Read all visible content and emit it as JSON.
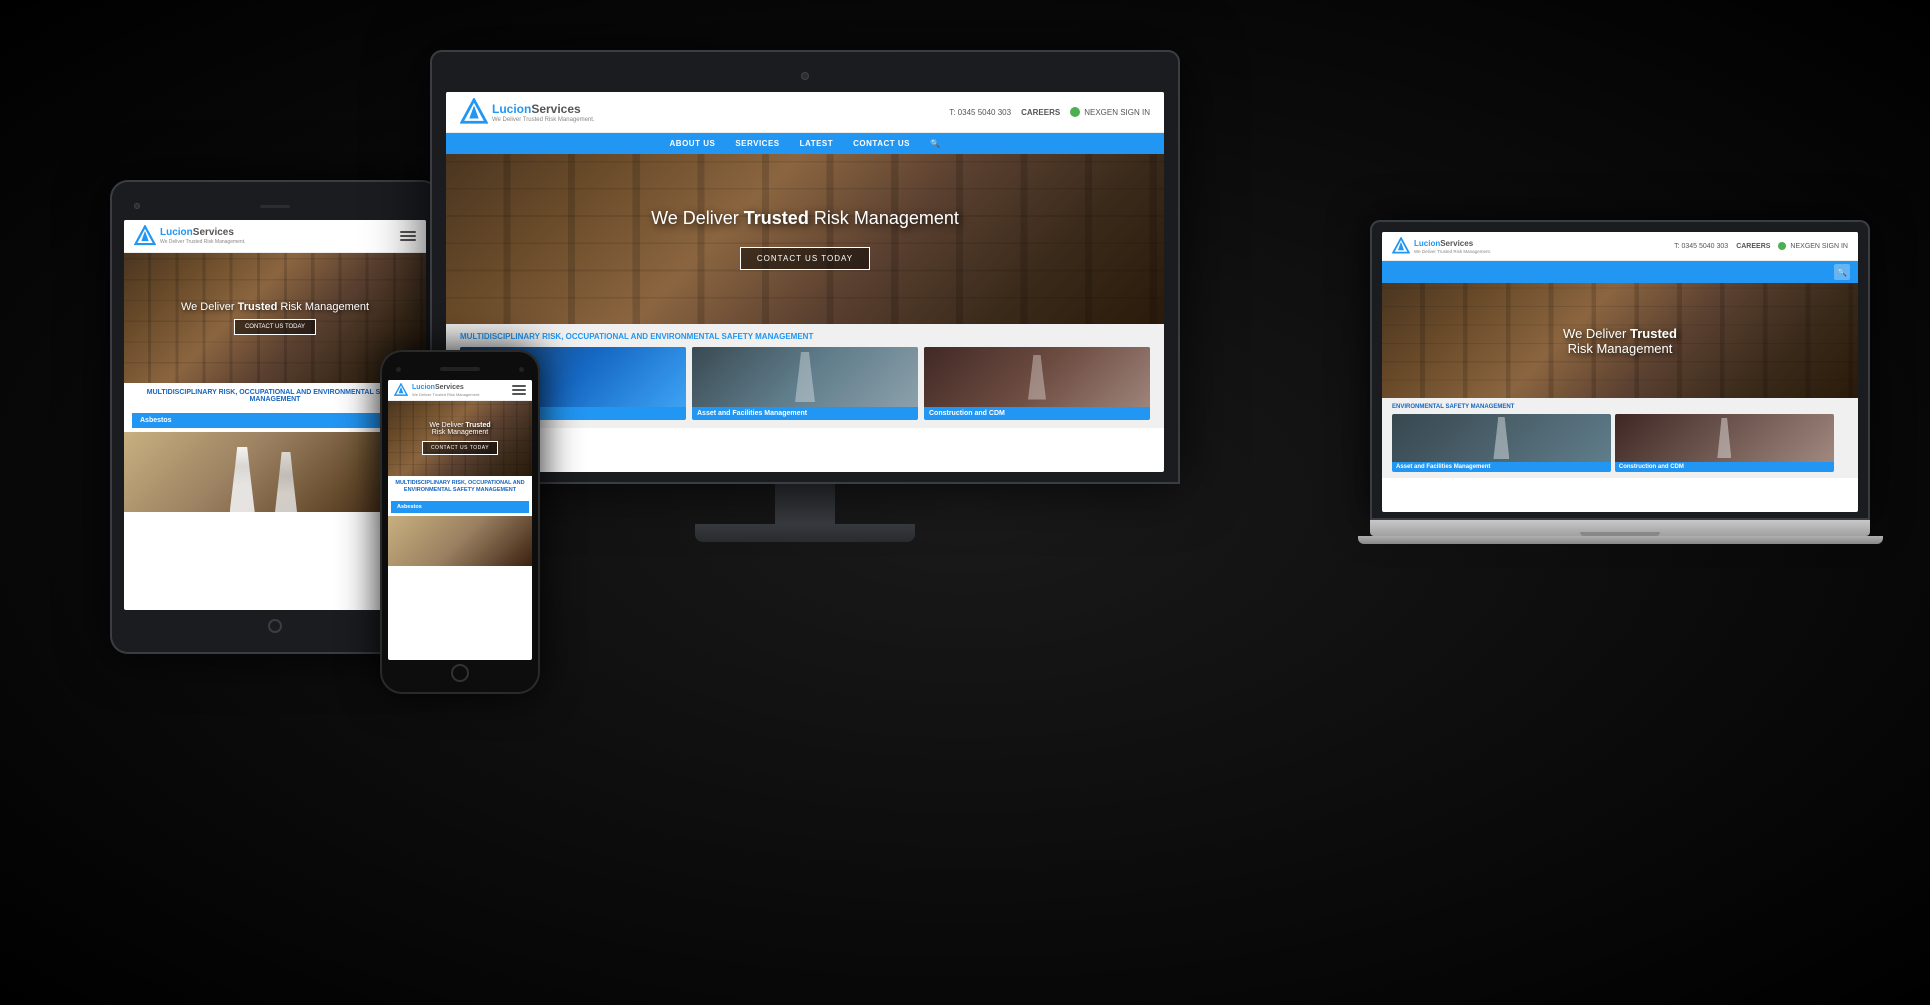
{
  "scene": {
    "background": "black"
  },
  "website": {
    "logo": {
      "brand_prefix": "Lucion",
      "brand_suffix": "Services",
      "tagline": "We Deliver Trusted Risk Management."
    },
    "header": {
      "phone": "T: 0345 5040 303",
      "careers": "CAREERS",
      "nexgen": "NEXGEN SIGN IN"
    },
    "nav": {
      "items": [
        "ABOUT US",
        "SERVICES",
        "LATEST",
        "CONTACT US"
      ]
    },
    "hero": {
      "headline_pre": "We Deliver ",
      "headline_bold": "Trusted",
      "headline_post": " Risk Management",
      "cta": "CONTACT US TODAY"
    },
    "services_section": {
      "title": "MULTIDISCIPLINARY RISK, OCCUPATIONAL AND ENVIRONMENTAL SAFETY MANAGEMENT",
      "cards": [
        {
          "label": "Asbestos"
        },
        {
          "label": "Asset and Facilities Management"
        },
        {
          "label": "Construction and CDM"
        }
      ]
    },
    "tablet_content": {
      "multidisc": "MULTIDISCIPLINARY RISK, OCCUPATIONAL AND ENVIRONMENTAL SAFETY MANAGEMENT",
      "asbestos": "Asbestos"
    },
    "phone_content": {
      "multidisc": "MULTIDISCIPLINARY RISK, OCCUPATIONAL AND ENVIRONMENTAL SAFETY MANAGEMENT",
      "asbestos": "Asbestos"
    }
  }
}
